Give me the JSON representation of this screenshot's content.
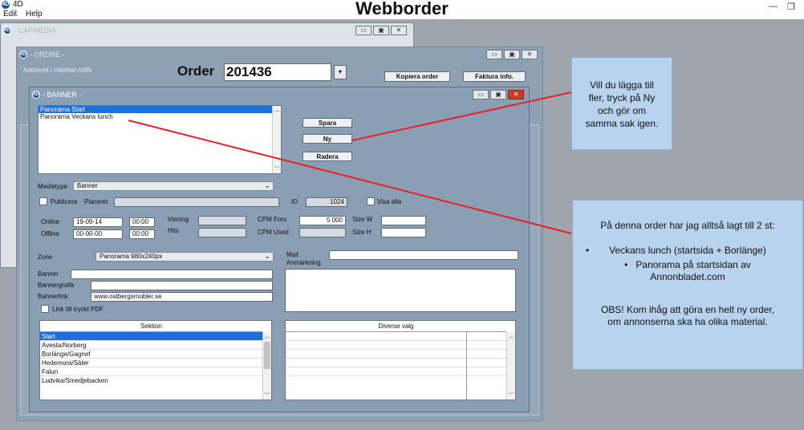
{
  "app": {
    "name": "4D",
    "logo": "4D",
    "menu": [
      "Edit",
      "Help"
    ]
  },
  "slide_title": "Webborder",
  "capmedia": {
    "title": "- CAPMEDIA -"
  },
  "ordre": {
    "title": "- ORDRE -",
    "archived_text": "Arkiveret i InterNet ANN",
    "order_label": "Order",
    "order_number": "201436",
    "buttons": {
      "copy": "Kopiera order",
      "invoice": "Faktura info."
    }
  },
  "banner": {
    "title": "- BANNER -",
    "list": [
      "Panorama Start",
      "Panorama Veckans lunch"
    ],
    "buttons": {
      "save": "Spara",
      "new": "Ny",
      "delete": "Radera"
    },
    "medietype": {
      "label": "Medietype",
      "value": "Banner"
    },
    "publicera": "Publicera",
    "placeret": "Placeret",
    "id_label": "ID",
    "id_value": "1024",
    "visa_alla": "Visa alla",
    "online": {
      "label": "Online",
      "date": "19-09-14",
      "time": "00:00"
    },
    "offline": {
      "label": "Offline",
      "date": "00-00-00",
      "time": "00:00"
    },
    "visning": "Visning",
    "hits": "Hits",
    "cpm_forv": {
      "label": "CPM Forv.",
      "value": "5 000"
    },
    "cpm_used": "CPM Used",
    "size_w": "Size W",
    "size_h": "Size H",
    "zone": {
      "label": "Zone",
      "value": "Panorama 980x240px"
    },
    "mail": "Mail",
    "anmarkning": "Anmärkning",
    "banner_label": "Banner",
    "bannergrafik": "Bannergrafik",
    "bannerlink": {
      "label": "Bannerlink",
      "value": "www.ostbergsmobler.se"
    },
    "link_pdf": "Link till tryckt PDF",
    "sektion": {
      "header": "Sektion",
      "rows": [
        "Start",
        "Avesta/Norberg",
        "Borlänge/Gagnef",
        "Hedemora/Säter",
        "Falun",
        "Ludvika/Smedjebacken"
      ]
    },
    "diverse": {
      "header": "Diverse valg"
    }
  },
  "callout1": {
    "lines": [
      "Vill du lägga till",
      "fler, tryck på Ny",
      "och gör om",
      "samma sak igen."
    ]
  },
  "callout2": {
    "intro": "På denna order har jag alltså lagt till 2 st:",
    "bullet1": "Veckans lunch (startsida + Borlänge)",
    "bullet2a": "Panorama på startsidan av",
    "bullet2b": "Annonbladet.com",
    "obs1": "OBS! Kom ihåg att göra en helt ny order,",
    "obs2": "om annonserna ska ha olika material."
  },
  "colors": {
    "arrow": "#e8202a",
    "selection": "#1e6fd9",
    "callout_bg": "#b7d3ee"
  }
}
